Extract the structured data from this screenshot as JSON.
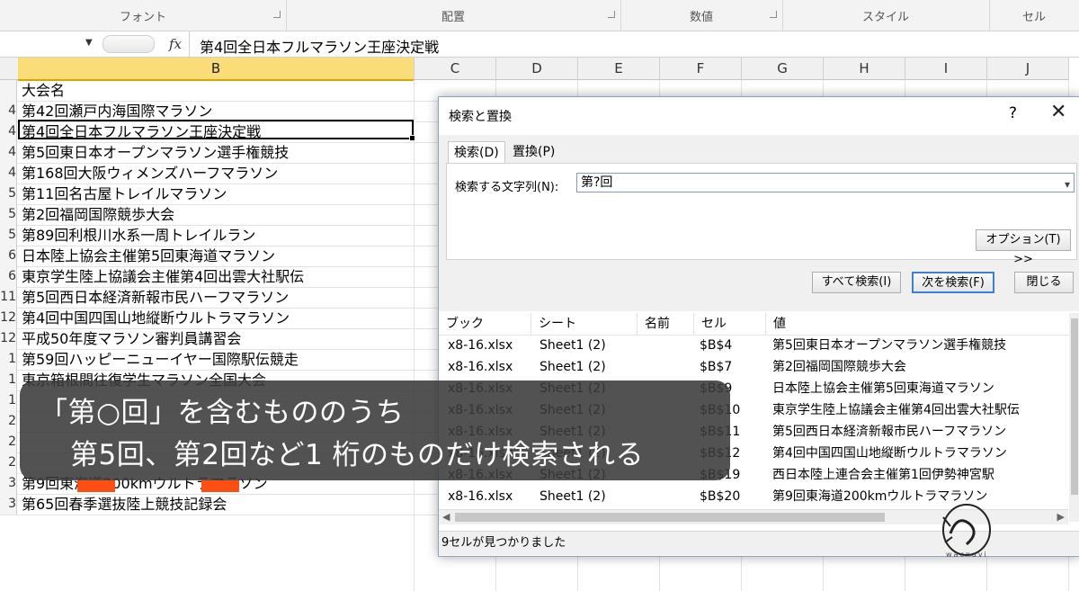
{
  "ribbon": {
    "groups": [
      "フォント",
      "配置",
      "数値",
      "スタイル",
      "セル"
    ]
  },
  "formula_bar": {
    "fx": "fx",
    "value": "第4回全日本フルマラソン王座決定戦"
  },
  "columns": [
    "B",
    "C",
    "D",
    "E",
    "F",
    "G",
    "H",
    "I",
    "J"
  ],
  "sheet": {
    "header_cell": "大会名",
    "rows": [
      {
        "num": "4",
        "name": "第42回瀬戸内海国際マラソン"
      },
      {
        "num": "4",
        "name": "第4回全日本フルマラソン王座決定戦"
      },
      {
        "num": "4",
        "name": "第5回東日本オープンマラソン選手権競技"
      },
      {
        "num": "4",
        "name": "第168回大阪ウィメンズハーフマラソン"
      },
      {
        "num": "5",
        "name": "第11回名古屋トレイルマラソン"
      },
      {
        "num": "5",
        "name": "第2回福岡国際競歩大会"
      },
      {
        "num": "5",
        "name": "第89回利根川水系一周トレイルラン"
      },
      {
        "num": "6",
        "name": "日本陸上協会主催第5回東海道マラソン"
      },
      {
        "num": "6",
        "name": "東京学生陸上協議会主催第4回出雲大社駅伝"
      },
      {
        "num": "11",
        "name": "第5回西日本経済新報市民ハーフマラソン"
      },
      {
        "num": "12",
        "name": "第4回中国四国山地縦断ウルトラマラソン"
      },
      {
        "num": "12",
        "name": "平成50年度マラソン審判員講習会"
      },
      {
        "num": "1",
        "name": "第59回ハッピーニューイヤー国際駅伝競走"
      },
      {
        "num": "1",
        "name": "東京箱根間往復学生マラソン全国大会"
      },
      {
        "num": "1",
        "name": ""
      },
      {
        "num": "2",
        "name": ""
      },
      {
        "num": "2",
        "name": ""
      },
      {
        "num": "2",
        "name": ""
      },
      {
        "num": "3",
        "name": "第9回東海道200kmウルトラマラソン"
      },
      {
        "num": "3",
        "name": "第65回春季選抜陸上競技記録会"
      }
    ]
  },
  "dialog": {
    "title": "検索と置換",
    "help": "?",
    "close": "✕",
    "tabs": [
      "検索(D)",
      "置換(P)"
    ],
    "find_label": "検索する文字列(N):",
    "find_value": "第?回",
    "options_button": "オプション(T) >>",
    "find_all_button": "すべて検索(I)",
    "find_next_button": "次を検索(F)",
    "close_button": "閉じる",
    "result_headers": [
      "ブック",
      "シート",
      "名前",
      "セル",
      "値"
    ],
    "results": [
      {
        "book": "x8-16.xlsx",
        "sheet": "Sheet1 (2)",
        "name": "",
        "cell": "$B$4",
        "value": "第5回東日本オープンマラソン選手権競技"
      },
      {
        "book": "x8-16.xlsx",
        "sheet": "Sheet1 (2)",
        "name": "",
        "cell": "$B$7",
        "value": "第2回福岡国際競歩大会"
      },
      {
        "book": "x8-16.xlsx",
        "sheet": "Sheet1 (2)",
        "name": "",
        "cell": "$B$9",
        "value": "日本陸上協会主催第5回東海道マラソン"
      },
      {
        "book": "x8-16.xlsx",
        "sheet": "Sheet1 (2)",
        "name": "",
        "cell": "$B$10",
        "value": "東京学生陸上協議会主催第4回出雲大社駅伝"
      },
      {
        "book": "x8-16.xlsx",
        "sheet": "Sheet1 (2)",
        "name": "",
        "cell": "$B$11",
        "value": "第5回西日本経済新報市民ハーフマラソン"
      },
      {
        "book": "x8-16.xlsx",
        "sheet": "Sheet1 (2)",
        "name": "",
        "cell": "$B$12",
        "value": "第4回中国四国山地縦断ウルトラマラソン"
      },
      {
        "book": "x8-16.xlsx",
        "sheet": "Sheet1 (2)",
        "name": "",
        "cell": "$B$19",
        "value": "西日本陸上連合会主催第1回伊勢神宮駅"
      },
      {
        "book": "x8-16.xlsx",
        "sheet": "Sheet1 (2)",
        "name": "",
        "cell": "$B$20",
        "value": "第9回東海道200kmウルトラマラソン"
      }
    ],
    "status": "9セルが見つかりました"
  },
  "caption": {
    "line1": "「第○回」を含むもののうち",
    "line2": "第5回、第2回など1 桁のものだけ検索される",
    "marker_color": "#ff4e12"
  },
  "watermark": {
    "text": "wacnavi"
  }
}
